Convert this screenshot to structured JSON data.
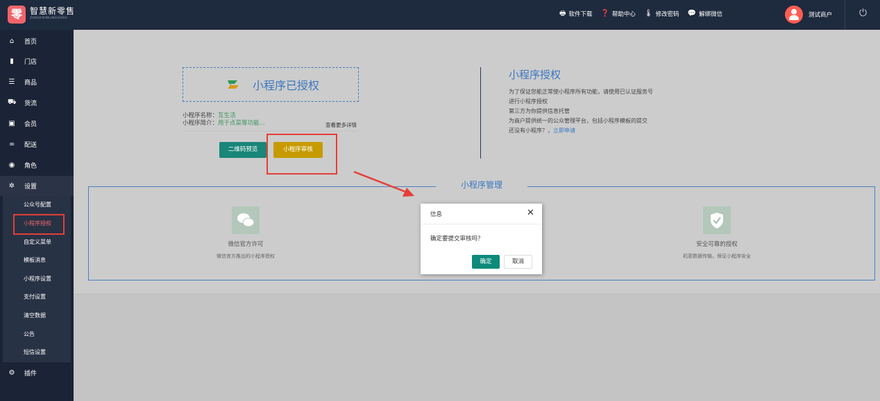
{
  "topbar": {
    "logo_char": "零",
    "brand_name": "智慧新零售",
    "brand_sub": "ZHIHUIXINLINGSHOU",
    "links": [
      {
        "icon": "download-icon",
        "label": "软件下载"
      },
      {
        "icon": "help-icon",
        "label": "帮助中心"
      },
      {
        "icon": "thermometer-icon",
        "label": "修改密码"
      },
      {
        "icon": "wechat-icon",
        "label": "解绑微信"
      }
    ],
    "username": "测试商户",
    "power_icon": "power-icon"
  },
  "sidebar": {
    "items": [
      {
        "icon": "home-icon",
        "label": "首页"
      },
      {
        "icon": "store-icon",
        "label": "门店"
      },
      {
        "icon": "list-icon",
        "label": "商品"
      },
      {
        "icon": "truck-icon",
        "label": "货流"
      },
      {
        "icon": "id-card-icon",
        "label": "会员"
      },
      {
        "icon": "motorcycle-icon",
        "label": "配送"
      },
      {
        "icon": "user-circle-icon",
        "label": "角色"
      },
      {
        "icon": "gear-icon",
        "label": "设置"
      }
    ],
    "submenu": [
      "公众号配置",
      "小程序授权",
      "自定义菜单",
      "模板消息",
      "小程序设置",
      "支付设置",
      "清空数据",
      "公告",
      "短信设置"
    ],
    "active_sub": "小程序授权",
    "plugins": {
      "icon": "gears-icon",
      "label": "插件"
    }
  },
  "auth": {
    "title": "小程序已授权",
    "name_label": "小程序名称：",
    "name_value": "互生活",
    "intro_label": "小程序简介：",
    "intro_value": "用于点菜等功能...",
    "more_link": "查看更多详情",
    "btn_qr": "二维码预览",
    "btn_review": "小程序审核"
  },
  "right_panel": {
    "title": "小程序授权",
    "desc1": "为了保证您能正常使小程序所有功能，请使用已认证服务号进行小程序授权",
    "desc2": "第三方为你提供信息托管",
    "desc3": "为商户提供统一的公众管理平台，包括小程序模板的提交",
    "desc4": "还没有小程序？，",
    "apply_link": "立即申请"
  },
  "management": {
    "title": "小程序管理",
    "features": [
      {
        "icon": "wechat-icon",
        "title": "微信官方许可",
        "sub": "微信官方推出的小程序授权"
      },
      {
        "icon": "shield-check-icon",
        "title": "安全可靠的授权",
        "sub": "机密数据传输，保证小程序安全"
      }
    ]
  },
  "dialog": {
    "title": "信息",
    "message": "确定要提交审核吗？",
    "ok": "确定",
    "cancel": "取消"
  },
  "colors": {
    "topbar": "#1e2a3e",
    "sidebar": "#1b2436",
    "accent_blue": "#3b78c0",
    "teal": "#1a8579",
    "gold": "#c79a00",
    "annotation_red": "#e53e36"
  }
}
